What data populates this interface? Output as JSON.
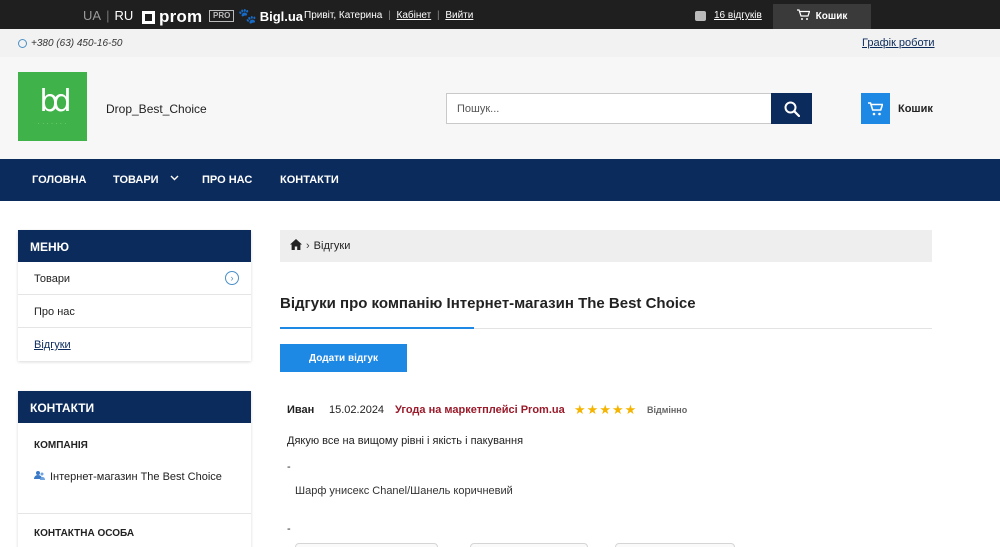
{
  "topbar": {
    "lang_ua": "UA",
    "lang_ru": "RU",
    "prom_label": "prom",
    "pro_badge": "PRO",
    "bigl_label": "Bigl.ua",
    "greeting": "Привіт, Катерина",
    "cabinet": "Кабінет",
    "logout": "Вийти",
    "reviews_count": "16 відгуків",
    "cart_label": "Кошик"
  },
  "phonerow": {
    "phone": "+380 (63) 450-16-50",
    "schedule": "Графік роботи"
  },
  "header": {
    "shop_name": "Drop_Best_Choice",
    "search_placeholder": "Пошук...",
    "cart_label": "Кошик"
  },
  "nav": {
    "home": "ГОЛОВНА",
    "goods": "ТОВАРИ",
    "about": "ПРО НАС",
    "contacts": "КОНТАКТИ"
  },
  "sidebar": {
    "menu_title": "МЕНЮ",
    "menu_items": [
      "Товари",
      "Про нас",
      "Відгуки"
    ],
    "contacts_title": "КОНТАКТИ",
    "company_label": "КОМПАНІЯ",
    "company_name": "Інтернет-магазин The Best Choice",
    "contact_person_label": "КОНТАКТНА ОСОБА"
  },
  "breadcrumb": {
    "current": "Відгуки"
  },
  "main": {
    "title": "Відгуки про компанію Інтернет-магазин The Best Choice",
    "add_review": "Додати відгук"
  },
  "review": {
    "author": "Иван",
    "date": "15.02.2024",
    "source": "Угода на маркетплейсі Prom.ua",
    "rating": 5,
    "rating_word": "Відмінно",
    "text": "Дякую все на вищому рівні і якість і пакування",
    "dash": "-",
    "product": "Шарф унисекс Chanel/Шанель коричневий"
  },
  "colors": {
    "brand_navy": "#0b2b5c",
    "accent_blue": "#1e88e5",
    "logo_green": "#3fb34a",
    "source_red": "#9a1a2a",
    "star_gold": "#f5b400"
  }
}
